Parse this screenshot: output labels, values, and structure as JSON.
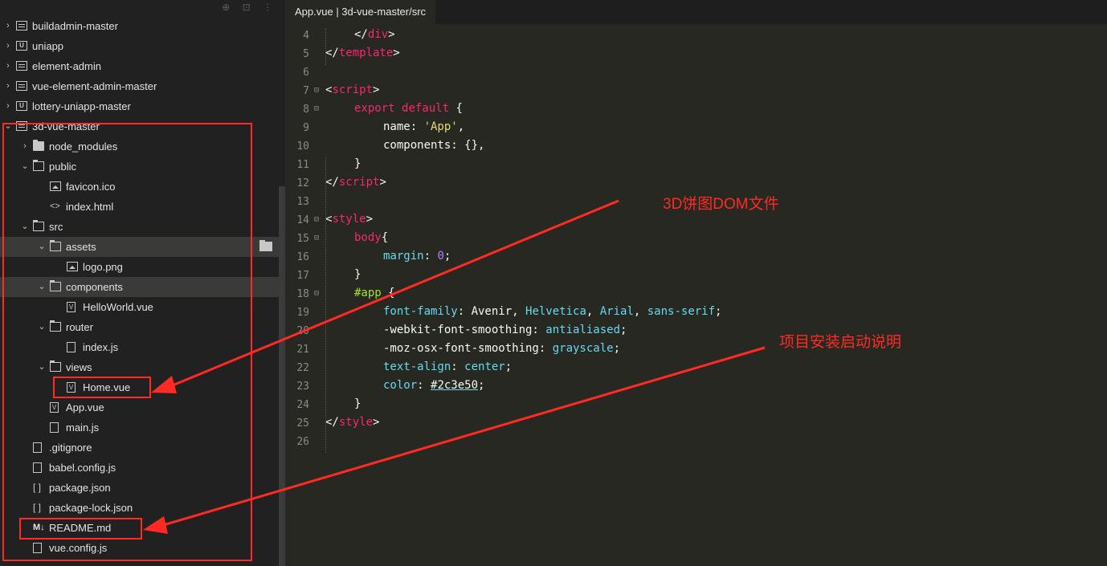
{
  "sidebar": {
    "header_icons": [
      "target-icon",
      "collapse-icon",
      "more-icon"
    ],
    "tree": [
      {
        "label": "buildadmin-master",
        "depth": 0,
        "arrow": "right",
        "icon": "project-icon"
      },
      {
        "label": "uniapp",
        "depth": 0,
        "arrow": "right",
        "icon": "uniapp-icon"
      },
      {
        "label": "element-admin",
        "depth": 0,
        "arrow": "right",
        "icon": "project-icon"
      },
      {
        "label": "vue-element-admin-master",
        "depth": 0,
        "arrow": "right",
        "icon": "project-icon"
      },
      {
        "label": "lottery-uniapp-master",
        "depth": 0,
        "arrow": "right",
        "icon": "uniapp-icon"
      },
      {
        "label": "3d-vue-master",
        "depth": 0,
        "arrow": "down",
        "icon": "project-icon"
      },
      {
        "label": "node_modules",
        "depth": 1,
        "arrow": "right",
        "icon": "folder-icon"
      },
      {
        "label": "public",
        "depth": 1,
        "arrow": "down",
        "icon": "folder-open-icon"
      },
      {
        "label": "favicon.ico",
        "depth": 2,
        "arrow": "",
        "icon": "image-file-icon"
      },
      {
        "label": "index.html",
        "depth": 2,
        "arrow": "",
        "icon": "code-file-icon"
      },
      {
        "label": "src",
        "depth": 1,
        "arrow": "down",
        "icon": "folder-open-icon"
      },
      {
        "label": "assets",
        "depth": 2,
        "arrow": "down",
        "icon": "folder-open-icon",
        "highlight": true
      },
      {
        "label": "logo.png",
        "depth": 3,
        "arrow": "",
        "icon": "image-file-icon"
      },
      {
        "label": "components",
        "depth": 2,
        "arrow": "down",
        "icon": "folder-open-icon",
        "highlight": true
      },
      {
        "label": "HelloWorld.vue",
        "depth": 3,
        "arrow": "",
        "icon": "vue-file-icon"
      },
      {
        "label": "router",
        "depth": 2,
        "arrow": "down",
        "icon": "folder-open-icon"
      },
      {
        "label": "index.js",
        "depth": 3,
        "arrow": "",
        "icon": "js-file-icon"
      },
      {
        "label": "views",
        "depth": 2,
        "arrow": "down",
        "icon": "folder-open-icon"
      },
      {
        "label": "Home.vue",
        "depth": 3,
        "arrow": "",
        "icon": "vue-file-icon"
      },
      {
        "label": "App.vue",
        "depth": 2,
        "arrow": "",
        "icon": "vue-file-icon"
      },
      {
        "label": "main.js",
        "depth": 2,
        "arrow": "",
        "icon": "js-file-icon"
      },
      {
        "label": ".gitignore",
        "depth": 1,
        "arrow": "",
        "icon": "file-icon"
      },
      {
        "label": "babel.config.js",
        "depth": 1,
        "arrow": "",
        "icon": "js-file-icon"
      },
      {
        "label": "package.json",
        "depth": 1,
        "arrow": "",
        "icon": "json-file-icon"
      },
      {
        "label": "package-lock.json",
        "depth": 1,
        "arrow": "",
        "icon": "json-file-icon"
      },
      {
        "label": "README.md",
        "depth": 1,
        "arrow": "",
        "icon": "markdown-file-icon"
      },
      {
        "label": "vue.config.js",
        "depth": 1,
        "arrow": "",
        "icon": "js-file-icon"
      }
    ]
  },
  "editor": {
    "tab_title": "App.vue | 3d-vue-master/src",
    "lines": [
      {
        "n": "4",
        "fold": "",
        "indent": 1,
        "tokens": [
          [
            "pn",
            "</"
          ],
          [
            "tg",
            "div"
          ],
          [
            "pn",
            ">"
          ]
        ]
      },
      {
        "n": "5",
        "fold": "",
        "indent": 0,
        "tokens": [
          [
            "pn",
            "</"
          ],
          [
            "tg",
            "template"
          ],
          [
            "pn",
            ">"
          ]
        ]
      },
      {
        "n": "6",
        "fold": "",
        "indent": 0,
        "tokens": []
      },
      {
        "n": "7",
        "fold": "⊟",
        "indent": 0,
        "tokens": [
          [
            "pn",
            "<"
          ],
          [
            "tg",
            "script"
          ],
          [
            "pn",
            ">"
          ]
        ]
      },
      {
        "n": "8",
        "fold": "⊟",
        "indent": 1,
        "tokens": [
          [
            "kw",
            "export"
          ],
          [
            "pn",
            " "
          ],
          [
            "kw",
            "default"
          ],
          [
            "pn",
            " {"
          ]
        ]
      },
      {
        "n": "9",
        "fold": "",
        "indent": 2,
        "tokens": [
          [
            "pn",
            "name: "
          ],
          [
            "str",
            "'App'"
          ],
          [
            "pn",
            ","
          ]
        ]
      },
      {
        "n": "10",
        "fold": "",
        "indent": 2,
        "tokens": [
          [
            "pn",
            "components: {},"
          ]
        ]
      },
      {
        "n": "11",
        "fold": "",
        "indent": 1,
        "tokens": [
          [
            "pn",
            "}"
          ]
        ]
      },
      {
        "n": "12",
        "fold": "",
        "indent": 0,
        "tokens": [
          [
            "pn",
            "</"
          ],
          [
            "tg",
            "script"
          ],
          [
            "pn",
            ">"
          ]
        ]
      },
      {
        "n": "13",
        "fold": "",
        "indent": 0,
        "tokens": []
      },
      {
        "n": "14",
        "fold": "⊟",
        "indent": 0,
        "tokens": [
          [
            "pn",
            "<"
          ],
          [
            "tg",
            "style"
          ],
          [
            "pn",
            ">"
          ]
        ]
      },
      {
        "n": "15",
        "fold": "⊟",
        "indent": 1,
        "tokens": [
          [
            "kw",
            "body"
          ],
          [
            "pn",
            "{"
          ]
        ]
      },
      {
        "n": "16",
        "fold": "",
        "indent": 2,
        "tokens": [
          [
            "prop",
            "margin"
          ],
          [
            "pn",
            ": "
          ],
          [
            "num",
            "0"
          ],
          [
            "pn",
            ";"
          ]
        ]
      },
      {
        "n": "17",
        "fold": "",
        "indent": 1,
        "tokens": [
          [
            "pn",
            "}"
          ]
        ]
      },
      {
        "n": "18",
        "fold": "⊟",
        "indent": 1,
        "tokens": [
          [
            "sel",
            "#app"
          ],
          [
            "pn",
            " {"
          ]
        ]
      },
      {
        "n": "19",
        "fold": "",
        "indent": 2,
        "tokens": [
          [
            "prop",
            "font-family"
          ],
          [
            "pn",
            ": Avenir, "
          ],
          [
            "prop",
            "Helvetica"
          ],
          [
            "pn",
            ", "
          ],
          [
            "prop",
            "Arial"
          ],
          [
            "pn",
            ", "
          ],
          [
            "prop",
            "sans-serif"
          ],
          [
            "pn",
            ";"
          ]
        ]
      },
      {
        "n": "20",
        "fold": "",
        "indent": 2,
        "tokens": [
          [
            "pn",
            "-webkit-font-smoothing: "
          ],
          [
            "prop",
            "antialiased"
          ],
          [
            "pn",
            ";"
          ]
        ]
      },
      {
        "n": "21",
        "fold": "",
        "indent": 2,
        "tokens": [
          [
            "pn",
            "-moz-osx-font-smoothing: "
          ],
          [
            "prop",
            "grayscale"
          ],
          [
            "pn",
            ";"
          ]
        ]
      },
      {
        "n": "22",
        "fold": "",
        "indent": 2,
        "tokens": [
          [
            "prop",
            "text-align"
          ],
          [
            "pn",
            ": "
          ],
          [
            "prop",
            "center"
          ],
          [
            "pn",
            ";"
          ]
        ]
      },
      {
        "n": "23",
        "fold": "",
        "indent": 2,
        "tokens": [
          [
            "prop",
            "color"
          ],
          [
            "pn",
            ": "
          ],
          [
            "ul",
            "#2c3e50"
          ],
          [
            "pn",
            ";"
          ]
        ]
      },
      {
        "n": "24",
        "fold": "",
        "indent": 1,
        "tokens": [
          [
            "pn",
            "}"
          ]
        ]
      },
      {
        "n": "25",
        "fold": "",
        "indent": 0,
        "tokens": [
          [
            "pn",
            "</"
          ],
          [
            "tg",
            "style"
          ],
          [
            "pn",
            ">"
          ]
        ]
      },
      {
        "n": "26",
        "fold": "",
        "indent": 0,
        "tokens": []
      }
    ]
  },
  "annotations": {
    "pie_dom_label": "3D饼图DOM文件",
    "readme_label": "项目安装启动说明",
    "color": "#ff2a22"
  }
}
